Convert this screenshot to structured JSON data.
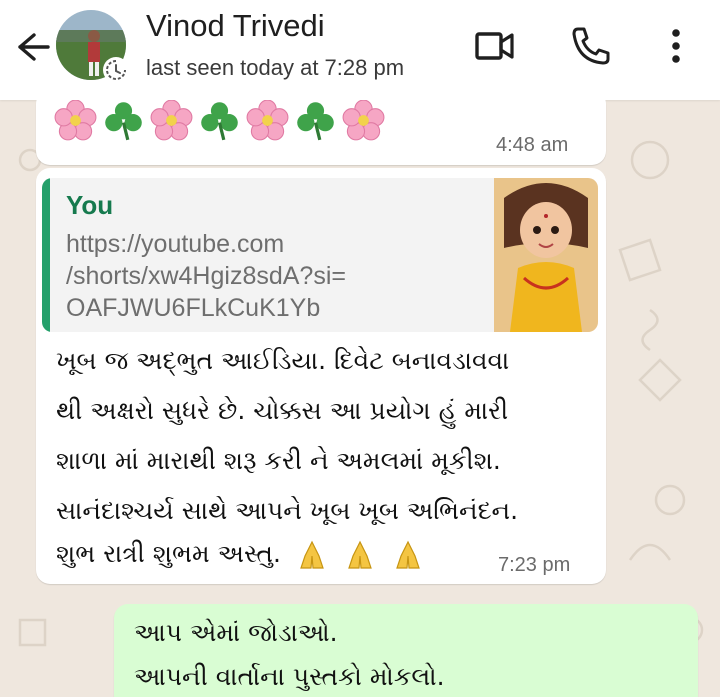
{
  "header": {
    "contact_name": "Vinod Trivedi",
    "last_seen": "last seen today at 7:28 pm",
    "icons": [
      "back-arrow-icon",
      "video-call-icon",
      "phone-icon",
      "more-options-icon",
      "status-clock-icon"
    ]
  },
  "messages": {
    "m1": {
      "emojis": [
        "cherry-blossom",
        "shamrock",
        "cherry-blossom",
        "shamrock",
        "cherry-blossom",
        "shamrock",
        "cherry-blossom"
      ],
      "time": "4:48 am"
    },
    "m2": {
      "quote": {
        "sender": "You",
        "lines": [
          "https://youtube.com",
          "/shorts/xw4Hgiz8sdA?si=",
          "OAFJWU6FLkCuK1Yb"
        ]
      },
      "lines": [
        "ખૂબ જ અદ્ભુત આઈડિયા. દિવેટ બનાવડાવવા",
        "થી અક્ષરો સુધરે છે. ચોક્કસ આ પ્રયોગ હું મારી",
        "શાળા માં મારાથી શરૂ કરી ને અમલમાં મૂકીશ.",
        "સાનંદાશ્ચર્ય સાથે આપને ખૂબ ખૂબ અભિનંદન.",
        "શુભ રાત્રી શુભમ અસ્તુ."
      ],
      "time": "7:23 pm"
    },
    "m3": {
      "lines": [
        "આપ એમાં જોડાઓ.",
        "આપની વાર્તાના પુસ્તકો મોકલો."
      ]
    }
  },
  "colors": {
    "chat_bg": "#efe7de",
    "outgoing_bubble": "#d9fdd3",
    "quote_accent": "#25a06b",
    "quote_sender": "#167a4e"
  }
}
